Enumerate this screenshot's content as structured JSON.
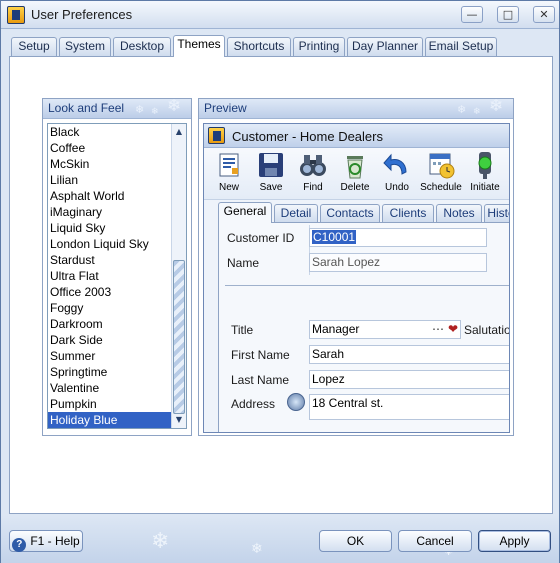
{
  "window": {
    "title": "User Preferences"
  },
  "tabs": [
    "Setup",
    "System",
    "Desktop",
    "Themes",
    "Shortcuts",
    "Printing",
    "Day Planner",
    "Email Setup"
  ],
  "active_tab": "Themes",
  "look_and_feel": {
    "header": "Look and Feel",
    "themes": [
      "Black",
      "Coffee",
      "McSkin",
      "Lilian",
      "Asphalt World",
      "iMaginary",
      "Liquid Sky",
      "London Liquid Sky",
      "Stardust",
      "Ultra Flat",
      "Office 2003",
      "Foggy",
      "Darkroom",
      "Dark Side",
      "Summer",
      "Springtime",
      "Valentine",
      "Pumpkin",
      "Holiday Blue"
    ],
    "selected": "Holiday Blue"
  },
  "preview": {
    "header": "Preview",
    "window_title": "Customer - Home Dealers",
    "toolbar": [
      "New",
      "Save",
      "Find",
      "Delete",
      "Undo",
      "Schedule",
      "Initiate"
    ],
    "tabs": [
      "General",
      "Detail",
      "Contacts",
      "Clients",
      "Notes",
      "Histo"
    ],
    "active_tab": "General",
    "fields": {
      "customer_id_label": "Customer ID",
      "customer_id_value": "C10001",
      "name_label": "Name",
      "name_value": "Sarah Lopez",
      "title_label": "Title",
      "title_value": "Manager",
      "salutation_label": "Salutation",
      "first_name_label": "First Name",
      "first_name_value": "Sarah",
      "last_name_label": "Last Name",
      "last_name_value": "Lopez",
      "address_label": "Address",
      "address_value": "18 Central st."
    }
  },
  "buttons": {
    "help": "F1 - Help",
    "ok": "OK",
    "cancel": "Cancel",
    "apply": "Apply"
  },
  "colors": {
    "accent": "#3162c5",
    "header": "#1d3d7a",
    "border": "#8ea3c4"
  }
}
